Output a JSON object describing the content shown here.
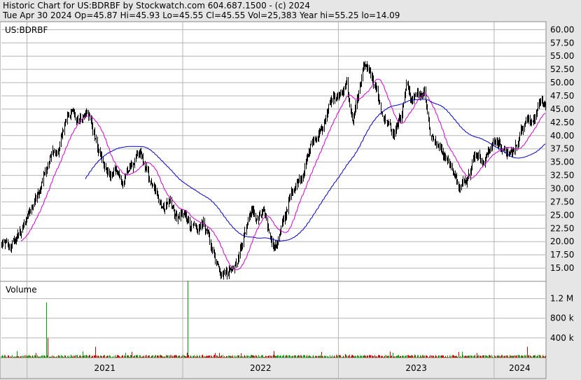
{
  "header": {
    "line1": "Historic Chart for US:BDRBF by Stockwatch.com 604.687.1500 - (c) 2024",
    "line2": "Tue Apr 30 2024   Op=45.87   Hi=45.93   Lo=45.55   Cl=45.55   Vol=25,383   Year hi=55.25   lo=14.09"
  },
  "colors": {
    "background": "#e6e6e6",
    "plot_bg": "#ffffff",
    "grid": "#b4b4b4",
    "price_bar": "#000000",
    "ma_short": "#d000d0",
    "ma_long": "#0000c8",
    "volume_up": "#00a000",
    "volume_down": "#d00000"
  },
  "chart_data": [
    {
      "type": "line",
      "panel": "price",
      "legend_label": "US:BDRBF",
      "grid": true,
      "ylim": [
        12.5,
        61.5
      ],
      "yticks": [
        "60.00",
        "57.50",
        "55.00",
        "52.50",
        "50.00",
        "47.50",
        "45.00",
        "42.50",
        "40.00",
        "37.50",
        "35.00",
        "32.50",
        "30.00",
        "27.50",
        "25.00",
        "22.50",
        "20.00",
        "17.50",
        "15.00"
      ],
      "x_start": "2020-11-02",
      "x_end": "2024-04-30",
      "x_labels": [
        "2021",
        "2022",
        "2023",
        "2024"
      ],
      "price_anchors": [
        [
          "2020-11-02",
          19.5
        ],
        [
          "2020-11-20",
          18.5
        ],
        [
          "2020-12-10",
          21
        ],
        [
          "2020-12-31",
          24
        ],
        [
          "2021-01-15",
          27
        ],
        [
          "2021-02-01",
          31
        ],
        [
          "2021-02-15",
          33.5
        ],
        [
          "2021-03-01",
          37
        ],
        [
          "2021-03-15",
          36
        ],
        [
          "2021-03-29",
          42
        ],
        [
          "2021-04-12",
          44.5
        ],
        [
          "2021-04-26",
          43
        ],
        [
          "2021-05-07",
          42.5
        ],
        [
          "2021-05-21",
          45
        ],
        [
          "2021-06-04",
          41
        ],
        [
          "2021-06-18",
          38
        ],
        [
          "2021-07-02",
          34
        ],
        [
          "2021-07-16",
          32
        ],
        [
          "2021-07-30",
          34
        ],
        [
          "2021-08-13",
          31
        ],
        [
          "2021-08-27",
          33.5
        ],
        [
          "2021-09-10",
          35
        ],
        [
          "2021-09-24",
          36
        ],
        [
          "2021-10-08",
          33
        ],
        [
          "2021-10-22",
          30
        ],
        [
          "2021-11-05",
          28
        ],
        [
          "2021-11-19",
          27
        ],
        [
          "2021-12-03",
          28
        ],
        [
          "2021-12-17",
          24
        ],
        [
          "2022-01-07",
          25
        ],
        [
          "2022-01-21",
          23
        ],
        [
          "2022-02-04",
          21
        ],
        [
          "2022-02-18",
          24
        ],
        [
          "2022-03-04",
          20
        ],
        [
          "2022-03-18",
          17
        ],
        [
          "2022-04-01",
          15
        ],
        [
          "2022-04-15",
          14.5
        ],
        [
          "2022-04-29",
          15.5
        ],
        [
          "2022-05-13",
          18
        ],
        [
          "2022-05-27",
          22
        ],
        [
          "2022-06-10",
          26
        ],
        [
          "2022-06-24",
          24
        ],
        [
          "2022-07-08",
          25
        ],
        [
          "2022-07-22",
          22
        ],
        [
          "2022-08-05",
          19
        ],
        [
          "2022-08-19",
          22
        ],
        [
          "2022-09-02",
          26
        ],
        [
          "2022-09-16",
          30
        ],
        [
          "2022-09-30",
          32
        ],
        [
          "2022-10-14",
          34
        ],
        [
          "2022-10-28",
          38
        ],
        [
          "2022-11-11",
          40
        ],
        [
          "2022-11-25",
          41
        ],
        [
          "2022-12-09",
          45
        ],
        [
          "2022-12-23",
          47
        ],
        [
          "2023-01-06",
          48
        ],
        [
          "2023-01-20",
          50
        ],
        [
          "2023-02-03",
          42
        ],
        [
          "2023-02-17",
          47
        ],
        [
          "2023-03-03",
          53
        ],
        [
          "2023-03-17",
          51
        ],
        [
          "2023-03-31",
          48
        ],
        [
          "2023-04-14",
          44
        ],
        [
          "2023-04-28",
          42
        ],
        [
          "2023-05-12",
          40
        ],
        [
          "2023-05-26",
          43
        ],
        [
          "2023-06-09",
          50
        ],
        [
          "2023-06-23",
          46
        ],
        [
          "2023-07-07",
          47
        ],
        [
          "2023-07-21",
          49
        ],
        [
          "2023-08-04",
          41
        ],
        [
          "2023-08-18",
          39
        ],
        [
          "2023-09-01",
          37
        ],
        [
          "2023-09-15",
          36
        ],
        [
          "2023-09-29",
          33
        ],
        [
          "2023-10-13",
          30
        ],
        [
          "2023-10-27",
          32
        ],
        [
          "2023-11-10",
          36
        ],
        [
          "2023-11-24",
          37
        ],
        [
          "2023-12-08",
          35
        ],
        [
          "2023-12-22",
          38
        ],
        [
          "2024-01-05",
          39
        ],
        [
          "2024-01-19",
          38
        ],
        [
          "2024-02-02",
          36
        ],
        [
          "2024-02-16",
          37
        ],
        [
          "2024-03-01",
          40
        ],
        [
          "2024-03-15",
          44
        ],
        [
          "2024-03-29",
          43
        ],
        [
          "2024-04-12",
          45
        ],
        [
          "2024-04-30",
          45.55
        ]
      ],
      "series": [
        {
          "kind": "ohlc",
          "color": "#000000"
        },
        {
          "kind": "moving_average",
          "color": "#d000d0",
          "period_days": 50
        },
        {
          "kind": "moving_average",
          "color": "#0000c8",
          "period_days": 200
        }
      ]
    },
    {
      "type": "bar",
      "panel": "volume",
      "title": "Volume",
      "ylim": [
        0,
        1550
      ],
      "yticks": [
        "1.2 M",
        "800 k",
        "400 k"
      ],
      "baseline_k": 30,
      "spikes": [
        [
          "2021-02-15",
          1120,
          "up"
        ],
        [
          "2021-02-18",
          400,
          "down"
        ],
        [
          "2021-06-10",
          220,
          "down"
        ],
        [
          "2022-01-12",
          1560,
          "up"
        ],
        [
          "2024-03-18",
          220,
          "down"
        ]
      ]
    }
  ]
}
